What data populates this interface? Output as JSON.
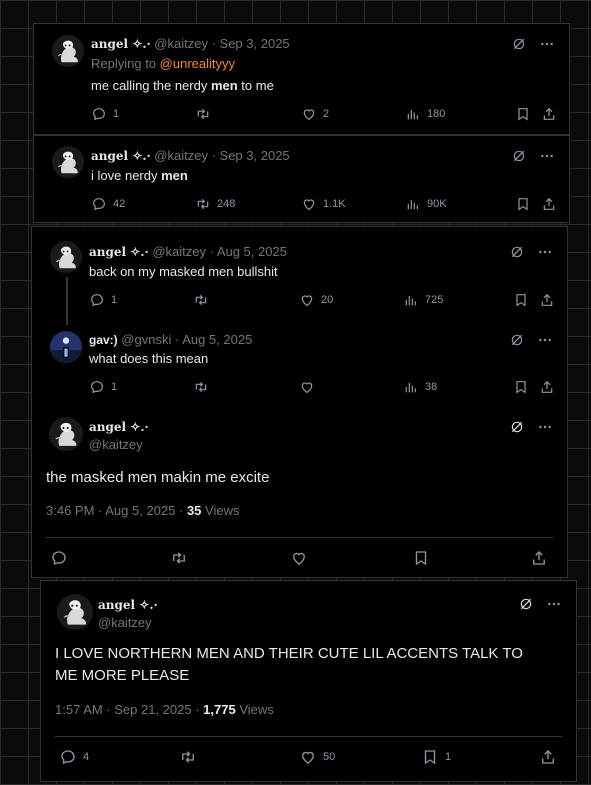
{
  "tweets": [
    {
      "name": "angel ✧.·",
      "handle": "@kaitzey",
      "date": "· Sep 3, 2025",
      "replying_prefix": "Replying to",
      "replying_to": "@unrealityyy",
      "text_pre": "me calling the nerdy ",
      "text_bold": "men",
      "text_post": " to me",
      "replies": "1",
      "retweets": "",
      "likes": "2",
      "views": "180"
    },
    {
      "name": "angel ✧.·",
      "handle": "@kaitzey",
      "date": "· Sep 3, 2025",
      "text_pre": "i love nerdy ",
      "text_bold": "men",
      "text_post": "",
      "replies": "42",
      "retweets": "248",
      "likes": "1.1K",
      "views": "90K"
    },
    {
      "name": "angel ✧.·",
      "handle": "@kaitzey",
      "date": "· Aug 5, 2025",
      "text": "back on my masked men bullshit",
      "replies": "1",
      "retweets": "",
      "likes": "20",
      "views": "725"
    },
    {
      "name": "gav:)",
      "handle": "@gvnski",
      "date": "· Aug 5, 2025",
      "text": "what does this mean",
      "replies": "1",
      "retweets": "",
      "likes": "",
      "views": "38"
    },
    {
      "name": "angel ✧.·",
      "handle": "@kaitzey",
      "text": "the masked men makin me excite",
      "time": "3:46 PM · Aug 5, 2025 ·",
      "views_count": "35",
      "views_label": "Views"
    },
    {
      "name": "angel ✧.·",
      "handle": "@kaitzey",
      "text": "I LOVE NORTHERN MEN AND THEIR CUTE LIL ACCENTS TALK TO ME MORE PLEASE",
      "time": "1:57 AM · Sep 21, 2025 ·",
      "views_count": "1,775",
      "views_label": "Views",
      "replies": "4",
      "retweets": "",
      "likes": "50",
      "bookmarks": "1"
    }
  ],
  "icons": [
    "reply-icon",
    "retweet-icon",
    "like-icon",
    "views-icon",
    "bookmark-icon",
    "share-icon",
    "grok-icon",
    "more-icon"
  ],
  "colors": {
    "mention": "#f08a24",
    "muted": "#71767b",
    "text": "#e7e9ea",
    "background": "#000000"
  }
}
